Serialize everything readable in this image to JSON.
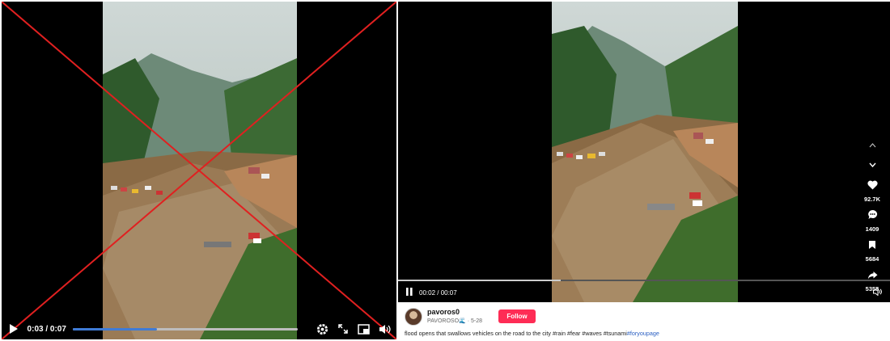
{
  "left_player": {
    "time": "0:03 / 0:07",
    "progress": 0.375,
    "icons": [
      "play-icon",
      "settings-gear-icon",
      "fullscreen-icon",
      "picture-in-picture-icon",
      "volume-icon"
    ]
  },
  "right_player": {
    "time": "00:02 / 00:07",
    "progress": 0.33,
    "likes": "92.7K",
    "comments": "1409",
    "saves": "5684",
    "shares": "5355",
    "username": "pavoros0",
    "handle_name": "PAVOROSO",
    "date": "5-28",
    "follow_label": "Follow",
    "caption_text": "flood opens that swallows vehicles on the road to the city #rain #fear #waves #tsunami",
    "caption_link": "#foryoupage"
  },
  "colors": {
    "follow_bg": "#fe2c55",
    "left_progress": "#3f7bd6",
    "cross": "#e02020"
  }
}
